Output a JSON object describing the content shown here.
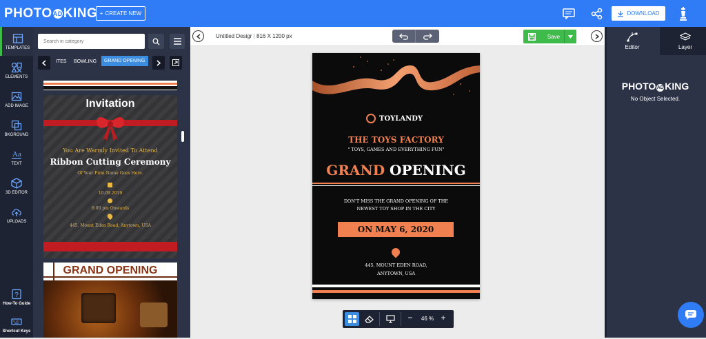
{
  "brand": {
    "logo": "PHOTO AD KING",
    "accent": "#2f7cf6",
    "green": "#3fbb4c",
    "orange": "#f08050"
  },
  "topbar": {
    "create_label": "CREATE NEW",
    "download_label": "DOWNLOAD"
  },
  "rail": {
    "items": [
      {
        "label": "TEMPLATES",
        "icon": "templates-icon"
      },
      {
        "label": "ELEMENTS",
        "icon": "elements-icon"
      },
      {
        "label": "ADD IMAGE",
        "icon": "add-image-icon"
      },
      {
        "label": "BKGROUND",
        "icon": "background-icon"
      },
      {
        "label": "TEXT",
        "icon": "text-icon"
      },
      {
        "label": "3D EDITOR",
        "icon": "3d-editor-icon"
      },
      {
        "label": "UPLOADS",
        "icon": "uploads-icon"
      },
      {
        "label": "How-To Guide",
        "icon": "help-icon"
      },
      {
        "label": "Shortcut Keys",
        "icon": "keyboard-icon"
      }
    ]
  },
  "panel": {
    "search_placeholder": "Search in category",
    "categories": [
      "ITES",
      "BOWLING",
      "GRAND OPENING"
    ],
    "invitation": {
      "title": "Invitation",
      "line1": "You Are Warmly Invited To Attend",
      "line2": "Ribbon Cutting Ceremony",
      "line3": "Of Your Firm Name Goes Here.",
      "date": "10.09.2019",
      "time": "6:00 pm Onwards",
      "address": "445, Mount Eden Road, Anytown, USA"
    },
    "grand_thumb_title": "GRAND OPENING"
  },
  "canvas": {
    "doc_title": "Untitled Desigr",
    "doc_size": "816 X 1200 px",
    "save_label": "Save"
  },
  "poster": {
    "brand": "TOYLANDY",
    "company": "THE TOYS FACTORY",
    "tagline": "\" TOYS, GAMES AND EVERYTHING FUN\"",
    "grand": "GRAND",
    "opening": "OPENING",
    "message1": "DON'T MISS THE GRAND OPENING OF THE",
    "message2": "NEWEST TOY SHOP IN THE CITY",
    "date": "ON MAY 6, 2020",
    "address1": "445, MOUNT EDEN ROAD,",
    "address2": "ANYTOWN, USA"
  },
  "zoom": {
    "level": "46 %",
    "minus": "−",
    "plus": "+"
  },
  "right_panel": {
    "tabs": [
      "Editor",
      "Layer"
    ],
    "logo": "PHOTO AD KING",
    "status": "No Object Selected."
  }
}
